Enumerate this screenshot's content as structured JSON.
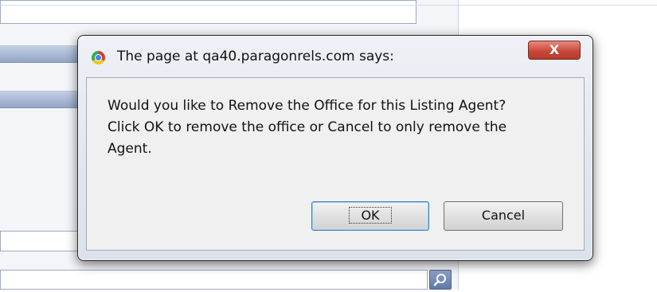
{
  "dialog": {
    "title": "The page at qa40.paragonrels.com says:",
    "close_label": "X",
    "message_lines": [
      "Would you like to Remove the Office for this Listing Agent?",
      " Click OK to remove the office or Cancel to only remove the",
      "Agent."
    ],
    "ok_label": "OK",
    "cancel_label": "Cancel"
  },
  "background": {
    "search_icon": "magnifier-icon"
  }
}
